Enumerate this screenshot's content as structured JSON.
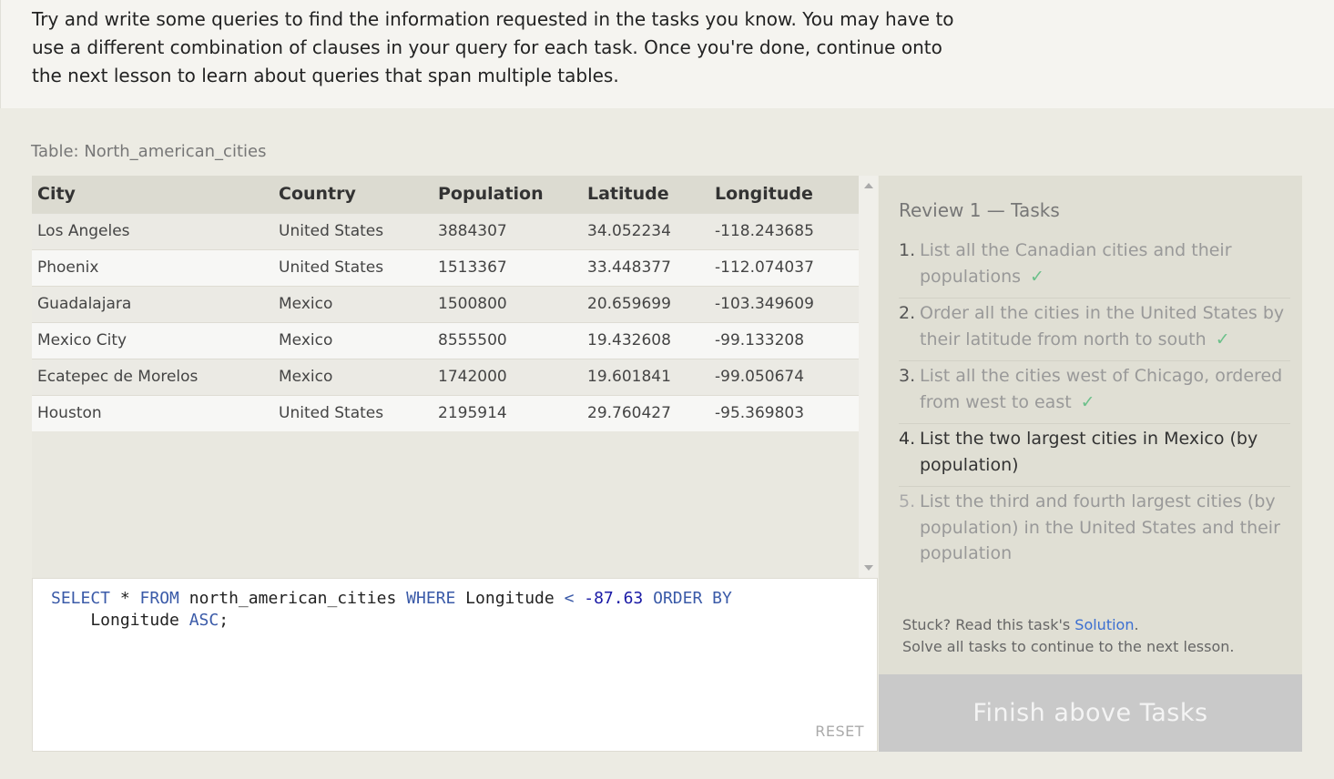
{
  "intro": {
    "text": "Try and write some queries to find the information requested in the tasks you know. You may have to use a different combination of clauses in your query for each task. Once you're done, continue onto the next lesson to learn about queries that span multiple tables."
  },
  "table": {
    "label": "Table: North_american_cities",
    "columns": [
      "City",
      "Country",
      "Population",
      "Latitude",
      "Longitude"
    ],
    "rows": [
      [
        "Los Angeles",
        "United States",
        "3884307",
        "34.052234",
        "-118.243685"
      ],
      [
        "Phoenix",
        "United States",
        "1513367",
        "33.448377",
        "-112.074037"
      ],
      [
        "Guadalajara",
        "Mexico",
        "1500800",
        "20.659699",
        "-103.349609"
      ],
      [
        "Mexico City",
        "Mexico",
        "8555500",
        "19.432608",
        "-99.133208"
      ],
      [
        "Ecatepec de Morelos",
        "Mexico",
        "1742000",
        "19.601841",
        "-99.050674"
      ],
      [
        "Houston",
        "United States",
        "2195914",
        "29.760427",
        "-95.369803"
      ]
    ]
  },
  "editor": {
    "query": {
      "select": "SELECT",
      "star": " * ",
      "from": "FROM",
      "table": " north_american_cities ",
      "where": "WHERE",
      "col": " Longitude ",
      "lt": "<",
      "value": "-87.63",
      "order_by": "ORDER BY",
      "col2": "    Longitude ",
      "asc": "ASC",
      "end": ";"
    },
    "reset_label": "RESET"
  },
  "tasks": {
    "title": "Review 1 — Tasks",
    "items": [
      {
        "n": "1.",
        "text": "List all the Canadian cities and their populations",
        "done": true
      },
      {
        "n": "2.",
        "text": "Order all the cities in the United States by their latitude from north to south",
        "done": true
      },
      {
        "n": "3.",
        "text": "List all the cities west of Chicago, ordered from west to east",
        "done": true
      },
      {
        "n": "4.",
        "text": "List the two largest cities in Mexico (by population)",
        "done": false
      },
      {
        "n": "5.",
        "text": "List the third and fourth largest cities (by population) in the United States and their population",
        "done": false
      }
    ],
    "check_glyph": "✓",
    "stuck_prefix": "Stuck? Read this task's ",
    "solution_link": "Solution",
    "stuck_suffix": ".",
    "solve_all": "Solve all tasks to continue to the next lesson."
  },
  "finish_button": "Finish above Tasks",
  "colors": {
    "accent_link": "#3b6fd1",
    "check": "#6cc08a",
    "keyword": "#3a5aa8"
  }
}
